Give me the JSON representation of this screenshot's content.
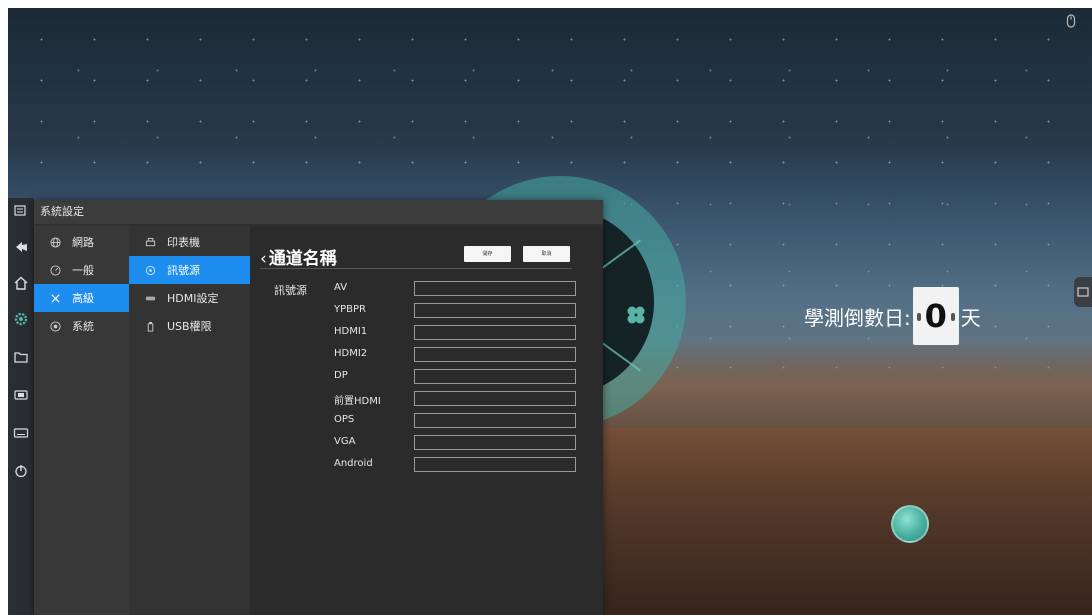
{
  "settings_window": {
    "title": "系統設定",
    "categories": [
      {
        "label": "網路",
        "icon": "globe-icon"
      },
      {
        "label": "一般",
        "icon": "gauge-icon"
      },
      {
        "label": "高級",
        "icon": "tools-icon",
        "active": true
      },
      {
        "label": "系統",
        "icon": "system-icon"
      }
    ],
    "subcategories": [
      {
        "label": "印表機",
        "icon": "printer-icon"
      },
      {
        "label": "訊號源",
        "icon": "signal-icon",
        "active": true
      },
      {
        "label": "HDMI設定",
        "icon": "hdmi-icon"
      },
      {
        "label": "USB權限",
        "icon": "usb-icon"
      }
    ],
    "page": {
      "back_glyph": "‹",
      "title": "通道名稱",
      "save_label": "儲存",
      "cancel_label": "取消",
      "section_label": "訊號源",
      "channels": [
        "AV",
        "YPBPR",
        "HDMI1",
        "HDMI2",
        "DP",
        "前置HDMI",
        "OPS",
        "VGA",
        "Android"
      ]
    }
  },
  "countdown": {
    "label": "學測倒數日:",
    "value": "0",
    "unit": "天"
  },
  "dock_icons": [
    "menu-icon",
    "back-icon",
    "home-icon",
    "settings-icon",
    "folder-icon",
    "source-icon",
    "keyboard-icon",
    "power-icon"
  ],
  "colors": {
    "accent": "#1e8df0",
    "teal": "#48b0a0"
  }
}
